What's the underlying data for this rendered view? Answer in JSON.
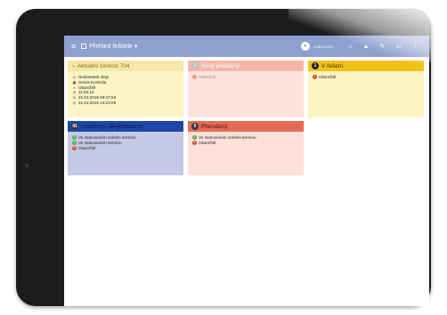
{
  "appbar": {
    "menu_icon": "menu-icon",
    "title": "Přehled řešitele ▾",
    "username": "KUBICKOVY"
  },
  "cards": {
    "current": {
      "title": "Aktuální činnost 704",
      "lines": [
        "Nedostatek oleje",
        "Servis Kontrola",
        "Okamžitě",
        "11:04:16",
        "22.02.2019 09:47:53",
        "21.02.2019 13:24:09"
      ]
    },
    "new": {
      "count": "1",
      "title": "Nový přidělený",
      "items": [
        {
          "badge": "1",
          "text": "Okamžitě"
        }
      ]
    },
    "inprogress": {
      "count": "1",
      "title": "V řešení",
      "items": [
        {
          "badge": "1",
          "text": "Okamžitě"
        }
      ]
    },
    "unfinished": {
      "count": "41",
      "title": "Uzavřený nevyhotovený",
      "items": [
        {
          "badge": "4",
          "text": "Ve stanoveném volném termínu"
        },
        {
          "badge": "1",
          "text": "Ve stanoveném termínu"
        },
        {
          "badge": "11",
          "text": "Okamžitě"
        }
      ]
    },
    "interrupted": {
      "count": "5",
      "title": "Přerušený",
      "items": [
        {
          "badge": "1",
          "text": "Ve stanoveném volném termínu"
        },
        {
          "badge": "4",
          "text": "Okamžitě"
        }
      ]
    }
  },
  "colors": {
    "appbar": "#8da0cf",
    "yellow_head": "#f6e7a4",
    "yellow_body": "#fbf4c6",
    "pink_head": "#f4b6ab",
    "pink_body": "#fde3dd",
    "gold_head": "#f2c21a",
    "gold_body": "#fbf4c0",
    "blue_head": "#1e46a8",
    "blue_body": "#c5c8e6",
    "red_head": "#e76a57",
    "red_body": "#fde0da"
  }
}
